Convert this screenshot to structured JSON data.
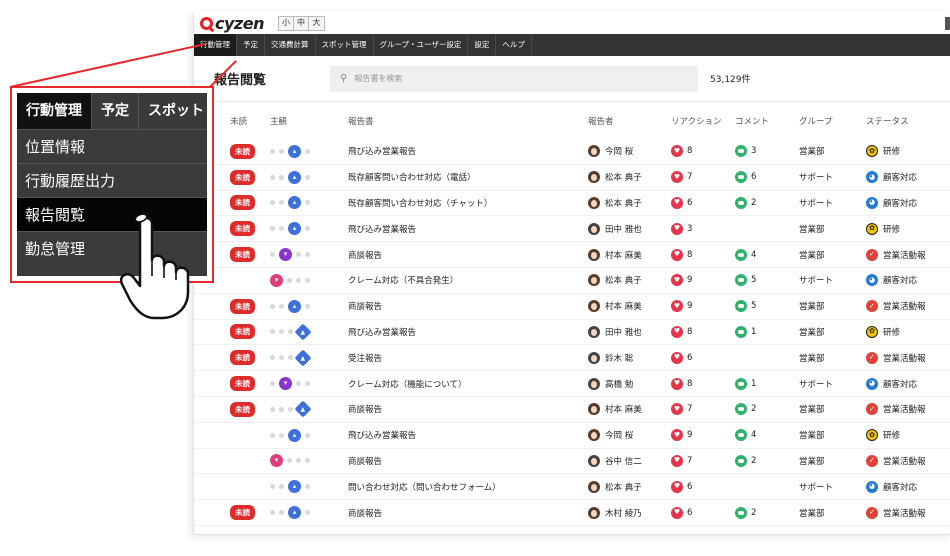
{
  "app": {
    "logo_text": "cyzen"
  },
  "size_buttons": [
    "小",
    "中",
    "大"
  ],
  "nav": [
    "行動管理",
    "予定",
    "交通費計算",
    "スポット管理",
    "グループ・ユーザー設定",
    "設定",
    "ヘルプ"
  ],
  "page": {
    "title": "報告閲覧",
    "search_placeholder": "報告書を検索",
    "count": "53,129件"
  },
  "columns": {
    "unread": "未読",
    "subjective": "主観",
    "report": "報告書",
    "reporter": "報告者",
    "reaction": "リアクション",
    "comment": "コメント",
    "group": "グループ",
    "status": "ステータス"
  },
  "colors": {
    "accent_red": "#e8282c",
    "nav_bg": "#333333",
    "unread_badge": "#e02b2b"
  },
  "rows": [
    {
      "unread": "未読",
      "mood": "blue",
      "report": "飛び込み営業報告",
      "reporter": "今岡 桜",
      "reactions": "8",
      "comments": "3",
      "group": "営業部",
      "status": "研修",
      "status_kind": "yellow"
    },
    {
      "unread": "未読",
      "mood": "blue",
      "report": "既存顧客問い合わせ対応（電話）",
      "reporter": "松本 典子",
      "reactions": "7",
      "comments": "6",
      "group": "サポート",
      "status": "顧客対応",
      "status_kind": "blue"
    },
    {
      "unread": "未読",
      "mood": "blue",
      "report": "既存顧客問い合わせ対応（チャット）",
      "reporter": "松本 典子",
      "reactions": "6",
      "comments": "2",
      "group": "サポート",
      "status": "顧客対応",
      "status_kind": "blue"
    },
    {
      "unread": "未読",
      "mood": "blue",
      "report": "飛び込み営業報告",
      "reporter": "田中 雅也",
      "reactions": "3",
      "comments": "",
      "group": "営業部",
      "status": "研修",
      "status_kind": "yellow"
    },
    {
      "unread": "未読",
      "mood": "purple",
      "report": "商談報告",
      "reporter": "村本 麻美",
      "reactions": "8",
      "comments": "4",
      "group": "営業部",
      "status": "営業活動報",
      "status_kind": "red"
    },
    {
      "unread": "",
      "mood": "pink",
      "report": "クレーム対応（不具合発生）",
      "reporter": "松本 典子",
      "reactions": "9",
      "comments": "5",
      "group": "サポート",
      "status": "顧客対応",
      "status_kind": "blue"
    },
    {
      "unread": "未読",
      "mood": "blue",
      "report": "商談報告",
      "reporter": "村本 麻美",
      "reactions": "9",
      "comments": "5",
      "group": "営業部",
      "status": "営業活動報",
      "status_kind": "red"
    },
    {
      "unread": "未読",
      "mood": "diamond",
      "report": "飛び込み営業報告",
      "reporter": "田中 雅也",
      "reactions": "8",
      "comments": "1",
      "group": "営業部",
      "status": "研修",
      "status_kind": "yellow"
    },
    {
      "unread": "未読",
      "mood": "diamond",
      "report": "受注報告",
      "reporter": "鈴木 聡",
      "reactions": "6",
      "comments": "",
      "group": "営業部",
      "status": "営業活動報",
      "status_kind": "red"
    },
    {
      "unread": "未読",
      "mood": "purple",
      "report": "クレーム対応（機能について）",
      "reporter": "高橋 勉",
      "reactions": "8",
      "comments": "1",
      "group": "サポート",
      "status": "顧客対応",
      "status_kind": "blue"
    },
    {
      "unread": "未読",
      "mood": "diamond",
      "report": "商談報告",
      "reporter": "村本 麻美",
      "reactions": "7",
      "comments": "2",
      "group": "営業部",
      "status": "営業活動報",
      "status_kind": "red"
    },
    {
      "unread": "",
      "mood": "blue",
      "report": "飛び込み営業報告",
      "reporter": "今岡 桜",
      "reactions": "9",
      "comments": "4",
      "group": "営業部",
      "status": "研修",
      "status_kind": "yellow"
    },
    {
      "unread": "",
      "mood": "pink",
      "report": "商談報告",
      "reporter": "谷中 信二",
      "reactions": "7",
      "comments": "2",
      "group": "営業部",
      "status": "営業活動報",
      "status_kind": "red"
    },
    {
      "unread": "",
      "mood": "blue",
      "report": "問い合わせ対応（問い合わせフォーム）",
      "reporter": "松本 典子",
      "reactions": "6",
      "comments": "",
      "group": "サポート",
      "status": "顧客対応",
      "status_kind": "blue"
    },
    {
      "unread": "未読",
      "mood": "blue",
      "report": "商談報告",
      "reporter": "木村 綾乃",
      "reactions": "6",
      "comments": "2",
      "group": "営業部",
      "status": "営業活動報",
      "status_kind": "red"
    }
  ],
  "zoom": {
    "tabs": [
      "行動管理",
      "予定",
      "スポット"
    ],
    "menu": [
      "位置情報",
      "行動履歴出力",
      "報告閲覧",
      "勤怠管理"
    ],
    "active_menu_index": 2
  }
}
